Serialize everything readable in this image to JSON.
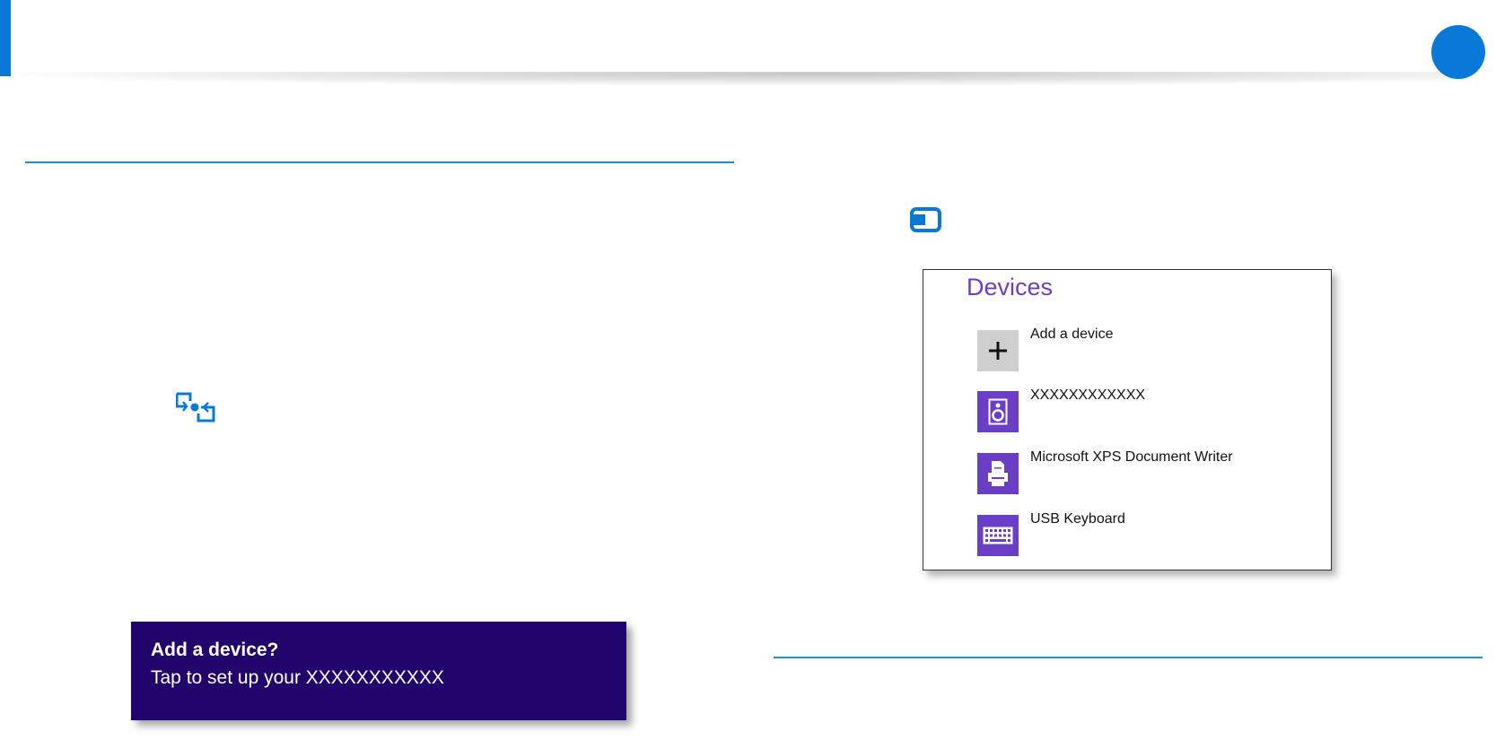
{
  "colors": {
    "accent_blue": "#0a78d6",
    "devices_purple": "#6b3fc5",
    "toast_background": "#22046d"
  },
  "icons": {
    "connect": "device-connect-icon",
    "charms_devices": "devices-charm-icon"
  },
  "devices_panel": {
    "title": "Devices",
    "items": [
      {
        "label": "Add a device",
        "icon": "plus-icon"
      },
      {
        "label": "XXXXXXXXXXXX",
        "icon": "speaker-icon"
      },
      {
        "label": "Microsoft XPS Document Writer",
        "icon": "printer-icon"
      },
      {
        "label": "USB Keyboard",
        "icon": "keyboard-icon"
      }
    ]
  },
  "toast": {
    "title": "Add a device?",
    "body": "Tap to set up your XXXXXXXXXXX"
  }
}
